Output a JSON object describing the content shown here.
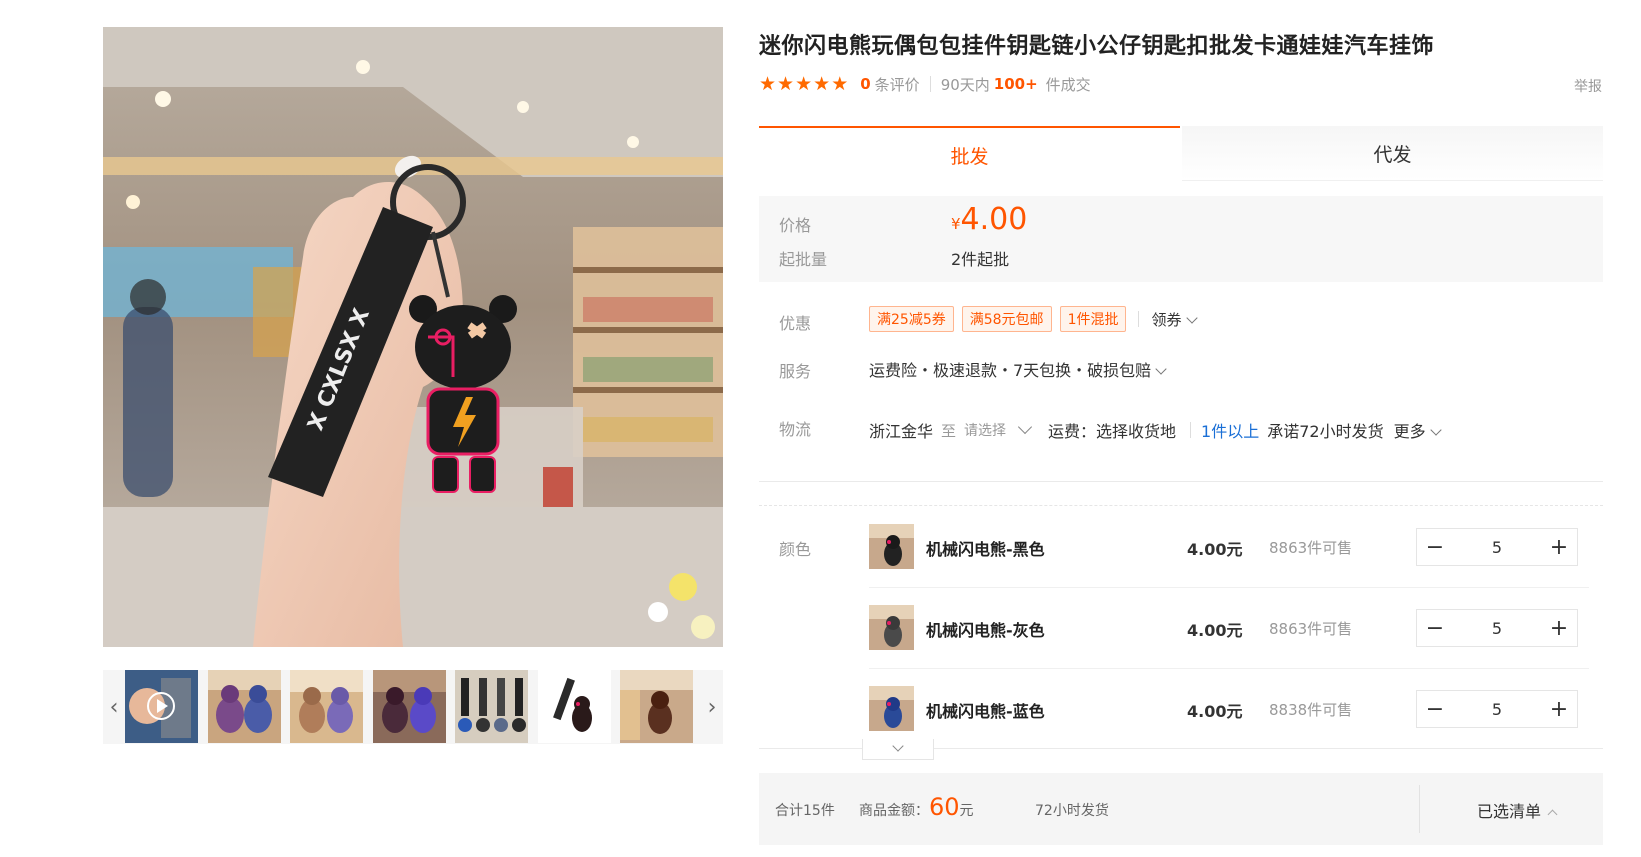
{
  "product": {
    "title": "迷你闪电熊玩偶包包挂件钥匙链小公仔钥匙扣批发卡通娃娃汽车挂饰",
    "review_count": "0",
    "review_label": "条评价",
    "sales_period": "90天内",
    "sales_count": "100+",
    "sales_label": "件成交",
    "report_label": "举报",
    "stars": 5
  },
  "gallery": {
    "main_keychain_text": "X CXLSX X",
    "thumbnails": 7,
    "prev_icon": "chevron-left-icon",
    "next_icon": "chevron-right-icon",
    "video_icon": "play-icon"
  },
  "tabs": [
    {
      "label": "批发",
      "active": true
    },
    {
      "label": "代发",
      "active": false
    }
  ],
  "price": {
    "label": "价格",
    "currency": "¥",
    "value": "4.00",
    "moq_label": "起批量",
    "moq_value": "2件起批"
  },
  "promo": {
    "label": "优惠",
    "tags": [
      "满25减5券",
      "满58元包邮",
      "1件混批"
    ],
    "coupon_label": "领券"
  },
  "service": {
    "label": "服务",
    "text": "运费险・极速退款・7天包换・破损包赔"
  },
  "logistics": {
    "label": "物流",
    "origin": "浙江金华",
    "to": "至",
    "destination_placeholder": "请选择",
    "fee": "运费：选择收货地",
    "min_qty": "1件以上",
    "promise": "承诺72小时发货",
    "more": "更多"
  },
  "sku": {
    "label": "颜色",
    "items": [
      {
        "name": "机械闪电熊-黑色",
        "price": "4.00元",
        "stock": "8863件可售",
        "qty": "5"
      },
      {
        "name": "机械闪电熊-灰色",
        "price": "4.00元",
        "stock": "8863件可售",
        "qty": "5"
      },
      {
        "name": "机械闪电熊-蓝色",
        "price": "4.00元",
        "stock": "8838件可售",
        "qty": "5"
      }
    ]
  },
  "summary": {
    "total_qty": "合计15件",
    "amount_label": "商品金额：",
    "amount_value": "60",
    "amount_unit": "元",
    "ship_note": "72小时发货",
    "selected_list": "已选清单"
  },
  "colors": {
    "accent": "#ff5500",
    "blue_link": "#1a6fd6",
    "star": "#ff6a00"
  }
}
